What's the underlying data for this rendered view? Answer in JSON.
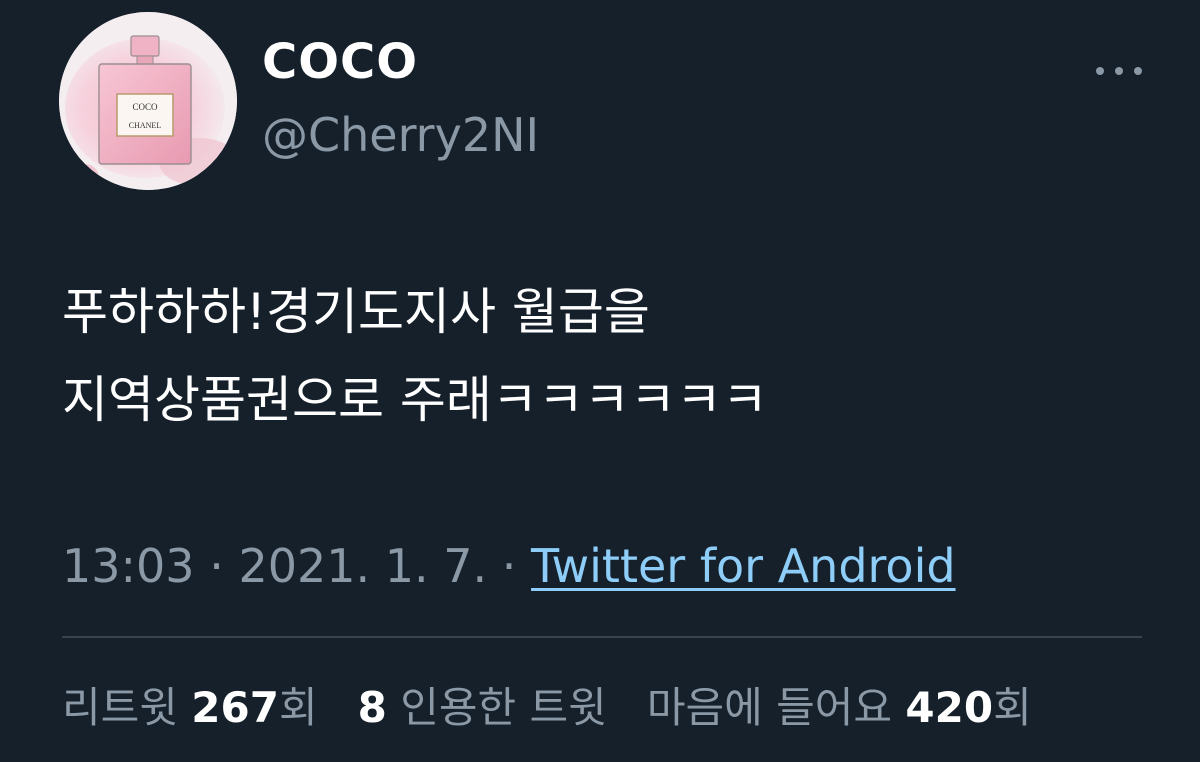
{
  "user": {
    "display_name": "COCO",
    "handle": "@Cherry2NI",
    "avatar_logo_text": "COCO CHANEL"
  },
  "tweet": {
    "text": "푸하하하!경기도지사 월급을\n지역상품권으로 주래ㅋㅋㅋㅋㅋㅋ",
    "time": "13:03",
    "separator1": " · ",
    "date": "2021. 1. 7.",
    "separator2": " · ",
    "source": "Twitter for Android"
  },
  "stats": {
    "retweets_label": "리트윗 ",
    "retweets_count": "267",
    "retweets_suffix": "회",
    "quotes_count": "8",
    "quotes_label": " 인용한 트윗",
    "likes_label": "마음에 들어요 ",
    "likes_count": "420",
    "likes_suffix": "회"
  },
  "icons": {
    "more": "more-horizontal-icon"
  },
  "colors": {
    "background": "#15202b",
    "primary_text": "#ffffff",
    "secondary_text": "#8b98a5",
    "link": "#8ecdf8",
    "divider": "#38444d"
  }
}
